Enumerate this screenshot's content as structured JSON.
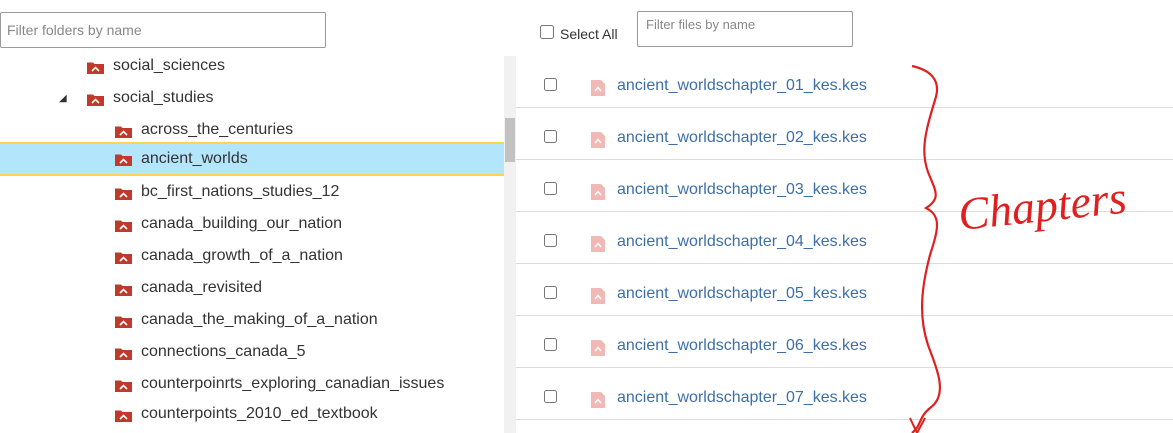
{
  "folder_filter": {
    "placeholder": "Filter folders by name"
  },
  "select_all": {
    "label": "Select All",
    "checked": false
  },
  "file_filter": {
    "placeholder": "Filter files by name"
  },
  "tree": {
    "items": [
      {
        "label": "social_sciences",
        "level": 1,
        "expanded": false,
        "selected": false
      },
      {
        "label": "social_studies",
        "level": 1,
        "expanded": true,
        "selected": false
      },
      {
        "label": "across_the_centuries",
        "level": 2,
        "selected": false
      },
      {
        "label": "ancient_worlds",
        "level": 2,
        "selected": true
      },
      {
        "label": "bc_first_nations_studies_12",
        "level": 2,
        "selected": false
      },
      {
        "label": "canada_building_our_nation",
        "level": 2,
        "selected": false
      },
      {
        "label": "canada_growth_of_a_nation",
        "level": 2,
        "selected": false
      },
      {
        "label": "canada_revisited",
        "level": 2,
        "selected": false
      },
      {
        "label": "canada_the_making_of_a_nation",
        "level": 2,
        "selected": false
      },
      {
        "label": "connections_canada_5",
        "level": 2,
        "selected": false
      },
      {
        "label": "counterpoinrts_exploring_canadian_issues",
        "level": 2,
        "selected": false
      },
      {
        "label": "counterpoints_2010_ed_textbook",
        "level": 2,
        "selected": false
      }
    ]
  },
  "files": [
    {
      "name": "ancient_worldschapter_01_kes.kes",
      "checked": false
    },
    {
      "name": "ancient_worldschapter_02_kes.kes",
      "checked": false
    },
    {
      "name": "ancient_worldschapter_03_kes.kes",
      "checked": false
    },
    {
      "name": "ancient_worldschapter_04_kes.kes",
      "checked": false
    },
    {
      "name": "ancient_worldschapter_05_kes.kes",
      "checked": false
    },
    {
      "name": "ancient_worldschapter_06_kes.kes",
      "checked": false
    },
    {
      "name": "ancient_worldschapter_07_kes.kes",
      "checked": false
    }
  ],
  "annotation": {
    "text": "Chapters",
    "color": "#e02020"
  },
  "colors": {
    "folder_icon": "#c0392b",
    "file_icon": "#f2b8b5",
    "selected_bg": "#b3e5fc",
    "selected_border": "#ffd54f",
    "link": "#3d6fa6"
  }
}
